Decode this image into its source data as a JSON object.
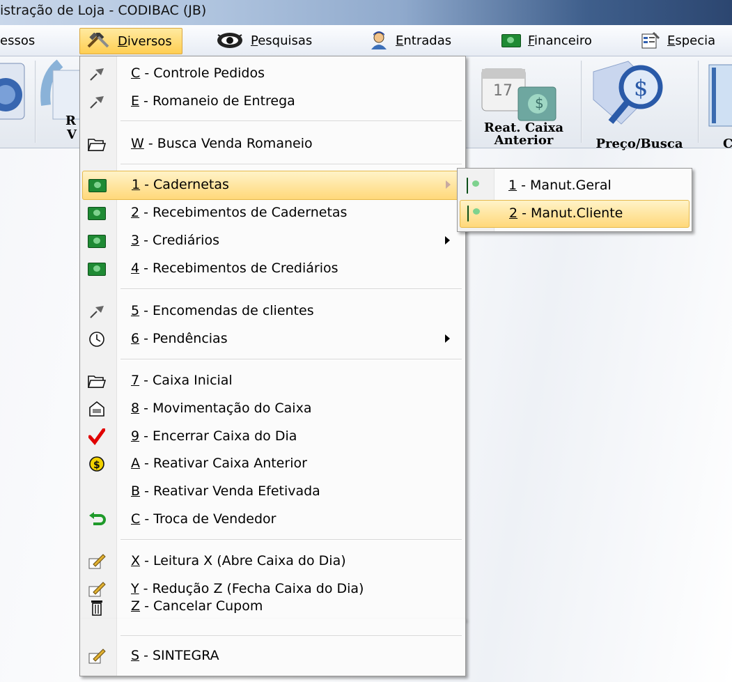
{
  "window": {
    "title": "istração de Loja - CODIBAC (JB)"
  },
  "menubar": {
    "items": [
      {
        "label": "essos",
        "icon": ""
      },
      {
        "label": "Diversos",
        "underline": "D",
        "icon": "tools-icon"
      },
      {
        "label": "Pesquisas",
        "underline": "P",
        "icon": "eye-icon"
      },
      {
        "label": "Entradas",
        "underline": "E",
        "icon": "person-icon"
      },
      {
        "label": "Financeiro",
        "underline": "F",
        "icon": "money-icon"
      },
      {
        "label": "Especia",
        "underline": "E",
        "icon": "properties-icon"
      }
    ]
  },
  "toolbar": {
    "buttons": [
      {
        "label_1": "Reat. Caixa",
        "label_2": "Anterior"
      },
      {
        "label_1": "Preço/Busca",
        "label_2": ""
      },
      {
        "label_1": "C",
        "label_2": ""
      }
    ],
    "partial_labels": {
      "r": "R",
      "v": "V"
    },
    "calendar_day": "17"
  },
  "dropdown": {
    "items": [
      {
        "key": "C",
        "text": " - Controle Pedidos",
        "icon": "pin-icon"
      },
      {
        "key": "E",
        "text": " - Romaneio de Entrega",
        "icon": "pin-icon"
      },
      {
        "key": "W",
        "text": " - Busca Venda Romaneio",
        "icon": "folder-open-icon"
      },
      {
        "key": "1",
        "text": " - Cadernetas",
        "icon": "money-icon",
        "submenu": true,
        "highlighted": true
      },
      {
        "key": "2",
        "text": " - Recebimentos de Cadernetas",
        "icon": "money-icon"
      },
      {
        "key": "3",
        "text": " - Crediários",
        "icon": "money-icon",
        "submenu": true
      },
      {
        "key": "4",
        "text": " - Recebimentos de Crediários",
        "icon": "money-icon"
      },
      {
        "key": "5",
        "text": " - Encomendas de clientes",
        "icon": "pin-icon"
      },
      {
        "key": "6",
        "text": " - Pendências",
        "icon": "clock-icon",
        "submenu": true
      },
      {
        "key": "7",
        "text": " - Caixa Inicial",
        "icon": "folder-open-icon"
      },
      {
        "key": "8",
        "text": " - Movimentação do Caixa",
        "icon": "cashbox-icon"
      },
      {
        "key": "9",
        "text": " - Encerrar Caixa do Dia",
        "icon": "checkmark-icon"
      },
      {
        "key": "A",
        "text": " - Reativar Caixa Anterior",
        "icon": "coin-icon"
      },
      {
        "key": "B",
        "text": " - Reativar Venda Efetivada",
        "icon": ""
      },
      {
        "key": "C",
        "text": " - Troca de Vendedor",
        "icon": "undo-arrow-icon"
      },
      {
        "key": "X",
        "text": " - Leitura X (Abre  Caixa do Dia)",
        "icon": "pencil-icon"
      },
      {
        "key": "Y",
        "text": " - Redução Z (Fecha Caixa do Dia)",
        "icon": "pencil-icon"
      },
      {
        "key": "Z",
        "text": " - Cancelar Cupom",
        "icon": "trash-icon"
      },
      {
        "key": "S",
        "text": " - SINTEGRA",
        "icon": "pencil-icon"
      }
    ]
  },
  "submenu": {
    "items": [
      {
        "key": "1",
        "text": " - Manut.Geral",
        "icon": "money-icon"
      },
      {
        "key": "2",
        "text": " - Manut.Cliente",
        "icon": "money-icon",
        "highlighted": true
      }
    ]
  },
  "colors": {
    "highlight": "#ffd87a",
    "highlight_border": "#e6b94b",
    "menu_bg": "#fbfbfb"
  }
}
